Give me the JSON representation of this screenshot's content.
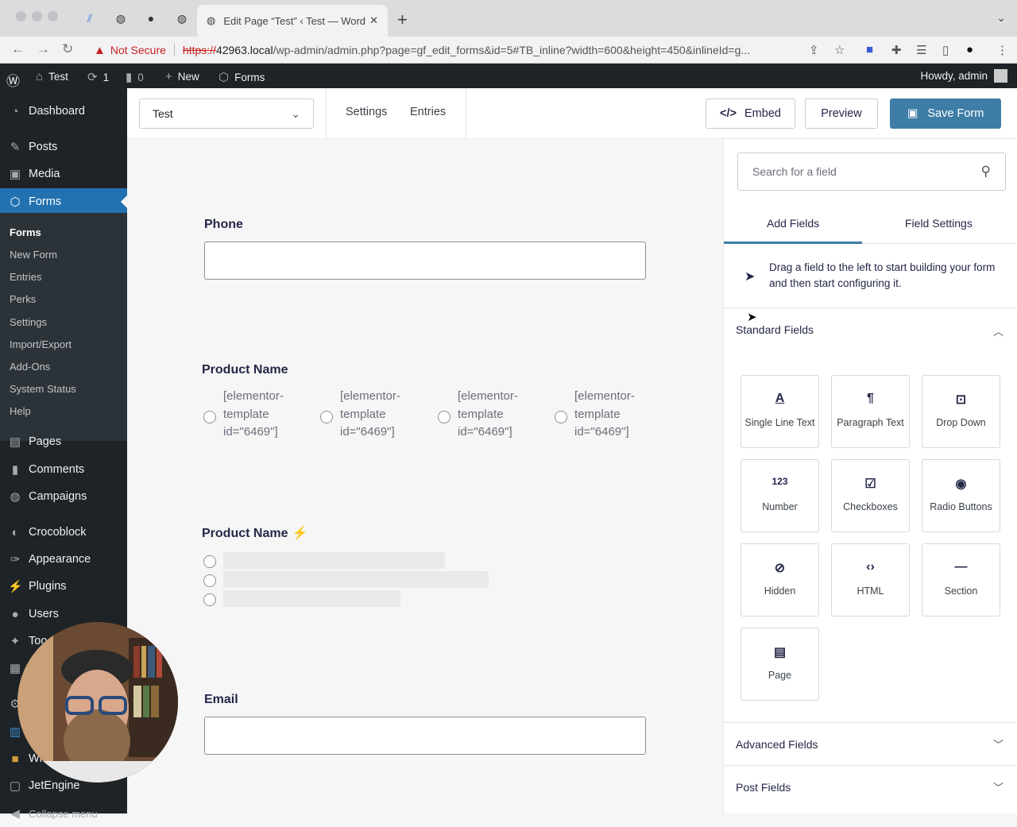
{
  "browser": {
    "active_tab_title": "Edit Page “Test” ‹ Test — Word",
    "security_label": "Not Secure",
    "url_scheme": "https://",
    "url_host": "42963.local",
    "url_rest": "/wp-admin/admin.php?page=gf_edit_forms&id=5#TB_inline?width=600&height=450&inlineId=g..."
  },
  "adminbar": {
    "site_name": "Test",
    "updates_count": "1",
    "comments_count": "0",
    "new_label": "New",
    "forms_label": "Forms",
    "howdy": "Howdy, admin"
  },
  "sidebar": {
    "items": [
      {
        "label": "Dashboard",
        "icon": "dashboard-icon"
      },
      {
        "label": "Posts",
        "icon": "pin-icon"
      },
      {
        "label": "Media",
        "icon": "media-icon"
      },
      {
        "label": "Forms",
        "icon": "forms-icon"
      },
      {
        "label": "Pages",
        "icon": "pages-icon"
      },
      {
        "label": "Comments",
        "icon": "comments-icon"
      },
      {
        "label": "Campaigns",
        "icon": "globe-icon"
      },
      {
        "label": "Crocoblock",
        "icon": "crocoblock-icon"
      },
      {
        "label": "Appearance",
        "icon": "brush-icon"
      },
      {
        "label": "Plugins",
        "icon": "plugin-icon"
      },
      {
        "label": "Users",
        "icon": "user-icon"
      },
      {
        "label": "Too",
        "icon": "wrench-icon"
      },
      {
        "label": "Wi",
        "icon": "folder-icon"
      },
      {
        "label": "JetEngine",
        "icon": "jet-icon"
      },
      {
        "label": "Collapse menu",
        "icon": "collapse-icon"
      }
    ],
    "submenu": [
      "Forms",
      "New Form",
      "Entries",
      "Perks",
      "Settings",
      "Import/Export",
      "Add-Ons",
      "System Status",
      "Help"
    ]
  },
  "editor": {
    "form_name": "Test",
    "settings_label": "Settings",
    "entries_label": "Entries",
    "embed_label": "Embed",
    "preview_label": "Preview",
    "save_label": "Save Form"
  },
  "canvas": {
    "phone_label": "Phone",
    "product_label_1": "Product Name",
    "radio_option": "[elementor-template id=\"6469\"]",
    "product_label_2": "Product Name",
    "email_label": "Email"
  },
  "panel": {
    "search_placeholder": "Search for a field",
    "tab_add": "Add Fields",
    "tab_settings": "Field Settings",
    "drag_hint": "Drag a field to the left to start building your form and then start configuring it.",
    "standard_title": "Standard Fields",
    "fields": [
      {
        "label": "Single Line Text",
        "icon": "single-line-text-icon"
      },
      {
        "label": "Paragraph Text",
        "icon": "paragraph-icon"
      },
      {
        "label": "Drop Down",
        "icon": "dropdown-icon"
      },
      {
        "label": "Number",
        "icon": "number-icon"
      },
      {
        "label": "Checkboxes",
        "icon": "checkbox-icon"
      },
      {
        "label": "Radio Buttons",
        "icon": "radio-icon"
      },
      {
        "label": "Hidden",
        "icon": "hidden-eye-icon"
      },
      {
        "label": "HTML",
        "icon": "code-icon"
      },
      {
        "label": "Section",
        "icon": "section-icon"
      },
      {
        "label": "Page",
        "icon": "page-icon"
      }
    ],
    "advanced_title": "Advanced Fields",
    "post_title": "Post Fields"
  },
  "colors": {
    "accent": "#2271b1",
    "save_button": "#3e7da6",
    "admin_bg": "#1d2327",
    "danger": "#c5221f"
  }
}
